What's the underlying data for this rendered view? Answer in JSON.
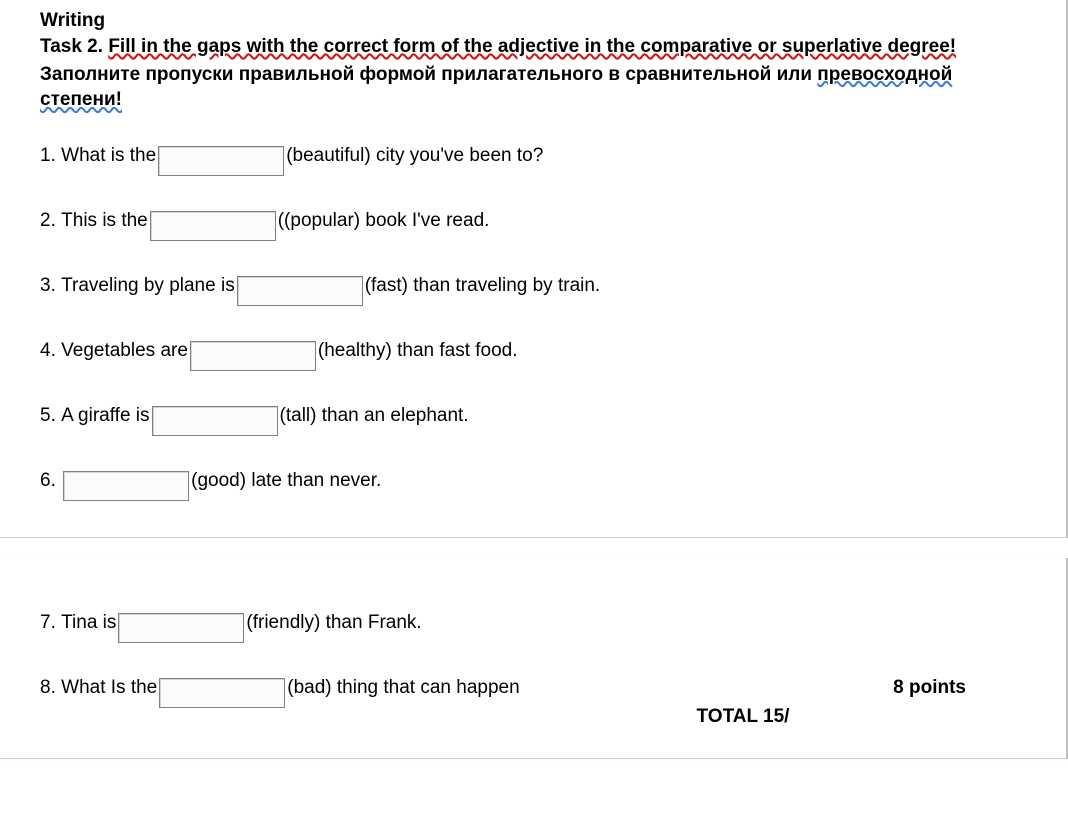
{
  "header": {
    "section_title": "Writing",
    "task_prefix": " Task 2. ",
    "task_instruction_en": "Fill in the gaps with the correct form of the adjective in the comparative or superlative degree!",
    "task_instruction_ru_part1": "Заполните пропуски правильной формой прилагательного в сравнительной или ",
    "task_instruction_ru_part2": "превосходной степени!"
  },
  "questions_page1": [
    {
      "num": "1.",
      "before": "What is the ",
      "after": "(beautiful) city you've been to?"
    },
    {
      "num": "2.",
      "before": "This is the ",
      "after": "((popular) book I've read."
    },
    {
      "num": "3.",
      "before": "Traveling by plane is ",
      "after": "(fast) than traveling by train."
    },
    {
      "num": "4.",
      "before": "Vegetables are ",
      "after": "(healthy) than fast food."
    },
    {
      "num": "5.",
      "before": "A giraffe is ",
      "after": "(tall) than an elephant."
    },
    {
      "num": "6.",
      "before": "",
      "after": "(good) late than never."
    }
  ],
  "questions_page2": [
    {
      "num": "7.",
      "before": "Tina is ",
      "after": "(friendly) than Frank."
    },
    {
      "num": "8.",
      "before": "What Is the ",
      "after": "(bad) thing that can happen"
    }
  ],
  "footer": {
    "points": "8 points",
    "total": "TOTAL 15/"
  }
}
